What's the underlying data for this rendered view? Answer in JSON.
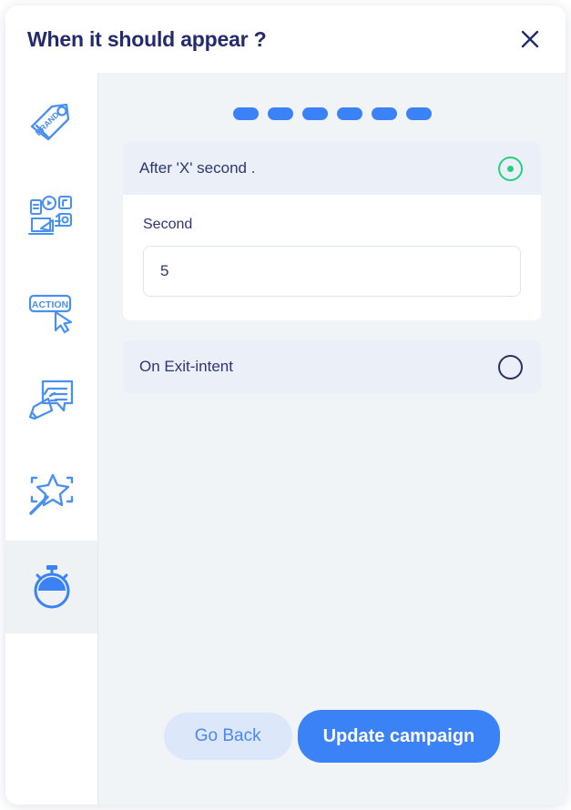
{
  "header": {
    "title": "When it should appear ?",
    "close_icon": "close-icon"
  },
  "sidebar": {
    "items": [
      {
        "icon": "brand-tag-icon",
        "name": "brand",
        "active": false
      },
      {
        "icon": "marketing-media-icon",
        "name": "marketing",
        "active": false
      },
      {
        "icon": "action-cursor-icon",
        "name": "action",
        "active": false
      },
      {
        "icon": "megaphone-message-icon",
        "name": "message",
        "active": false
      },
      {
        "icon": "magic-wand-icon",
        "name": "design",
        "active": false
      },
      {
        "icon": "stopwatch-icon",
        "name": "timing",
        "active": true
      }
    ]
  },
  "steps": {
    "total": 6,
    "current": 6,
    "items": [
      {
        "active": true
      },
      {
        "active": true
      },
      {
        "active": true
      },
      {
        "active": true
      },
      {
        "active": true
      },
      {
        "active": true
      }
    ]
  },
  "options": [
    {
      "label": "After 'X' second .",
      "selected": true,
      "field_label": "Second",
      "field_value": "5",
      "field_placeholder": "Second"
    },
    {
      "label": "On Exit-intent",
      "selected": false
    }
  ],
  "footer": {
    "back_label": "Go Back",
    "submit_label": "Update campaign"
  },
  "colors": {
    "accent_blue": "#3b82f6",
    "radio_selected_green": "#25d07d",
    "radio_unselected": "#2a2f63",
    "title_navy": "#232a6e",
    "content_bg": "#f1f4f7",
    "option_bg": "#ebeff8",
    "back_btn_bg": "#dce8fa"
  }
}
